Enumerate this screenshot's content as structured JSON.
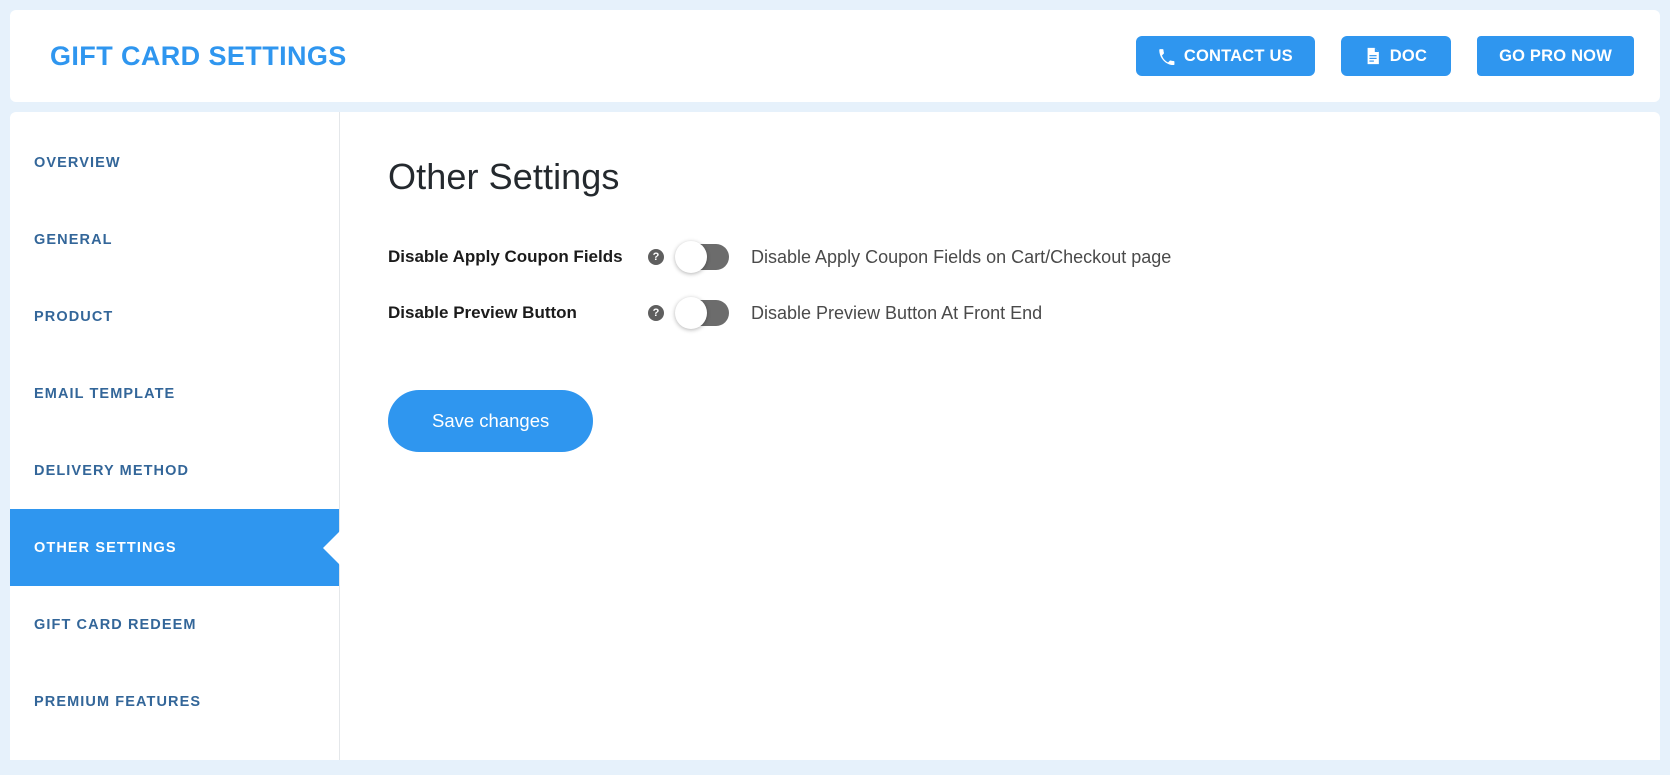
{
  "header": {
    "title": "GIFT CARD SETTINGS",
    "accent_color": "#2f96ef",
    "buttons": [
      {
        "label": "CONTACT US",
        "icon": "phone-icon"
      },
      {
        "label": "DOC",
        "icon": "document-icon"
      },
      {
        "label": "GO PRO NOW",
        "icon": ""
      }
    ]
  },
  "sidebar": {
    "items": [
      {
        "label": "OVERVIEW",
        "active": false
      },
      {
        "label": "GENERAL",
        "active": false
      },
      {
        "label": "PRODUCT",
        "active": false
      },
      {
        "label": "EMAIL TEMPLATE",
        "active": false
      },
      {
        "label": "DELIVERY METHOD",
        "active": false
      },
      {
        "label": "OTHER SETTINGS",
        "active": true
      },
      {
        "label": "GIFT CARD REDEEM",
        "active": false
      },
      {
        "label": "PREMIUM FEATURES",
        "active": false
      }
    ]
  },
  "main": {
    "title": "Other Settings",
    "settings": [
      {
        "label": "Disable Apply Coupon Fields",
        "help": "?",
        "toggle_state": "off",
        "description": "Disable Apply Coupon Fields on Cart/Checkout page"
      },
      {
        "label": "Disable Preview Button",
        "help": "?",
        "toggle_state": "off",
        "description": "Disable Preview Button At Front End"
      }
    ],
    "save_label": "Save changes"
  },
  "colors": {
    "page_background": "#e6f1fb",
    "card_background": "#ffffff",
    "accent": "#2f96ef",
    "nav_text": "#336699",
    "toggle_track_off": "#6c6c6c"
  }
}
